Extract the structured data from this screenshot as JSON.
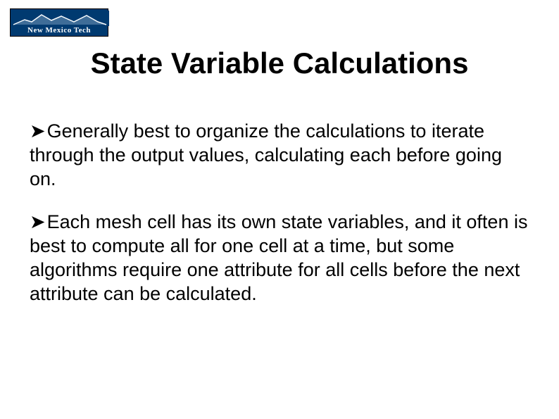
{
  "logo": {
    "text": "New Mexico Tech"
  },
  "title": "State Variable Calculations",
  "bullets": [
    "Generally best to organize the calculations to iterate through the output values, calculating each before going on.",
    "Each mesh cell has its own state variables, and it often is best to compute all for one cell at a time, but some algorithms require one attribute for all cells before the next attribute can be calculated."
  ]
}
